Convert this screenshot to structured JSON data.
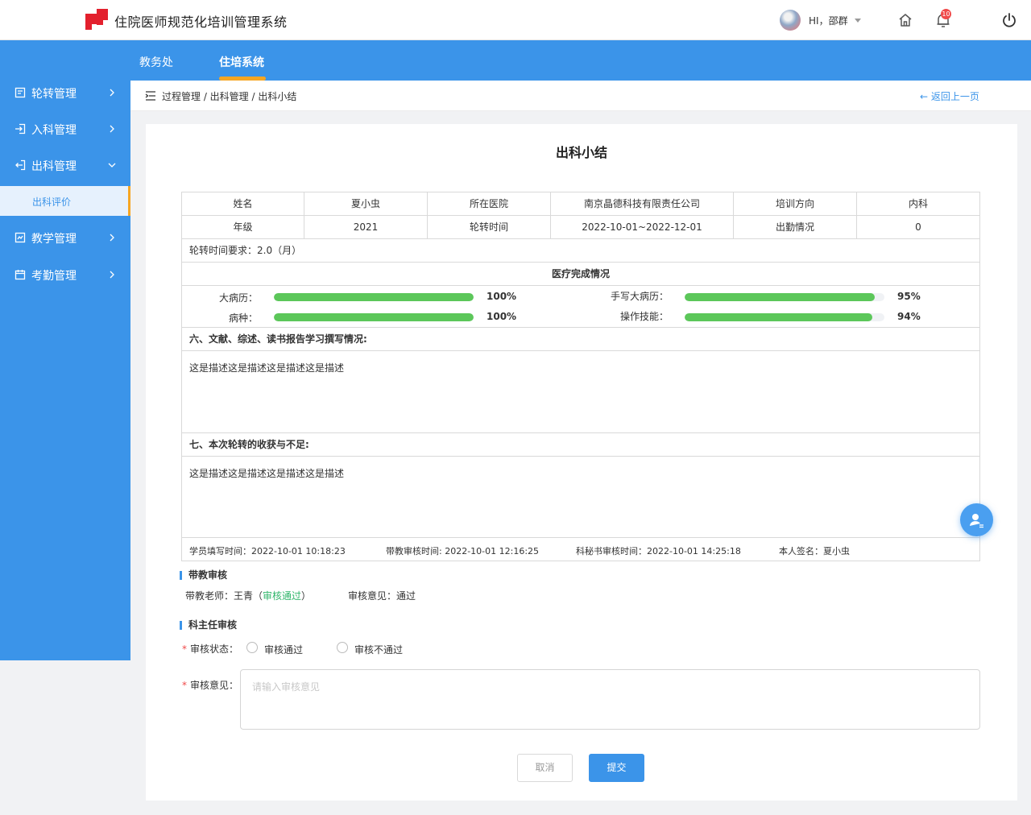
{
  "app": {
    "title": "住院医师规范化培训管理系统",
    "logo_icon": "bp-logo"
  },
  "header": {
    "user_greeting": "HI，邵群",
    "notification_count": "10",
    "icons": {
      "home": "home-icon",
      "bell": "bell-icon",
      "power": "power-icon"
    }
  },
  "nav": {
    "tabs": [
      {
        "label": "教务处"
      },
      {
        "label": "住培系统"
      }
    ],
    "active": "住培系统"
  },
  "sidebar": {
    "items": [
      {
        "label": "轮转管理",
        "icon": "rotation-icon"
      },
      {
        "label": "入科管理",
        "icon": "login-icon"
      },
      {
        "label": "出科管理",
        "icon": "logout-icon",
        "expanded": true
      },
      {
        "label": "教学管理",
        "icon": "teaching-icon"
      },
      {
        "label": "考勤管理",
        "icon": "calendar-icon"
      }
    ],
    "sub_item": "出科评价"
  },
  "breadcrumb": {
    "text": "过程管理 / 出科管理 / 出科小结",
    "back": "← 返回上一页"
  },
  "form": {
    "title": "出科小结",
    "info": {
      "name_label": "姓名",
      "name": "夏小虫",
      "hospital_label": "所在医院",
      "hospital": "南京晶德科技有限责任公司",
      "direction_label": "培训方向",
      "direction": "内科",
      "grade_label": "年级",
      "grade": "2021",
      "period_label": "轮转时间",
      "period": "2022-10-01~2022-12-01",
      "attendance_label": "出勤情况",
      "attendance": "0"
    },
    "requirement": "轮转时间要求：2.0（月）",
    "completion_title": "医疗完成情况",
    "progress": [
      {
        "label": "大病历：",
        "percent": 100,
        "text": "100%"
      },
      {
        "label": "手写大病历：",
        "percent": 95,
        "text": "95%"
      },
      {
        "label": "病种：",
        "percent": 100,
        "text": "100%"
      },
      {
        "label": "操作技能：",
        "percent": 94,
        "text": "94%"
      }
    ],
    "section6_title": "六、文献、综述、读书报告学习撰写情况:",
    "section6_body": "这是描述这是描述这是描述这是描述",
    "section7_title": "七、本次轮转的收获与不足:",
    "section7_body": "这是描述这是描述这是描述这是描述",
    "footer": {
      "student_time": "学员填写时间：2022-10-01 10:18:23",
      "teacher_time": "带教审核时间: 2022-10-01 12:16:25",
      "secretary_time": "科秘书审核时间：2022-10-01 14:25:18",
      "signature": "本人签名：夏小虫"
    }
  },
  "teacher_review": {
    "title": "带教审核",
    "teacher_prefix": "带教老师：王青（",
    "status": "审核通过",
    "teacher_suffix": "）",
    "opinion": "审核意见：通过"
  },
  "director_review": {
    "title": "科主任审核",
    "status_label": "审核状态：",
    "options": [
      "审核通过",
      "审核不通过"
    ],
    "opinion_label": "审核意见：",
    "opinion_placeholder": "请输入审核意见",
    "required_mark": "*"
  },
  "buttons": {
    "cancel": "取消",
    "submit": "提交"
  },
  "colors": {
    "primary": "#3b94e9",
    "accent": "#f6a623",
    "progress": "#5cc75a",
    "success": "#2fb56a",
    "badge": "#f04a4a"
  }
}
